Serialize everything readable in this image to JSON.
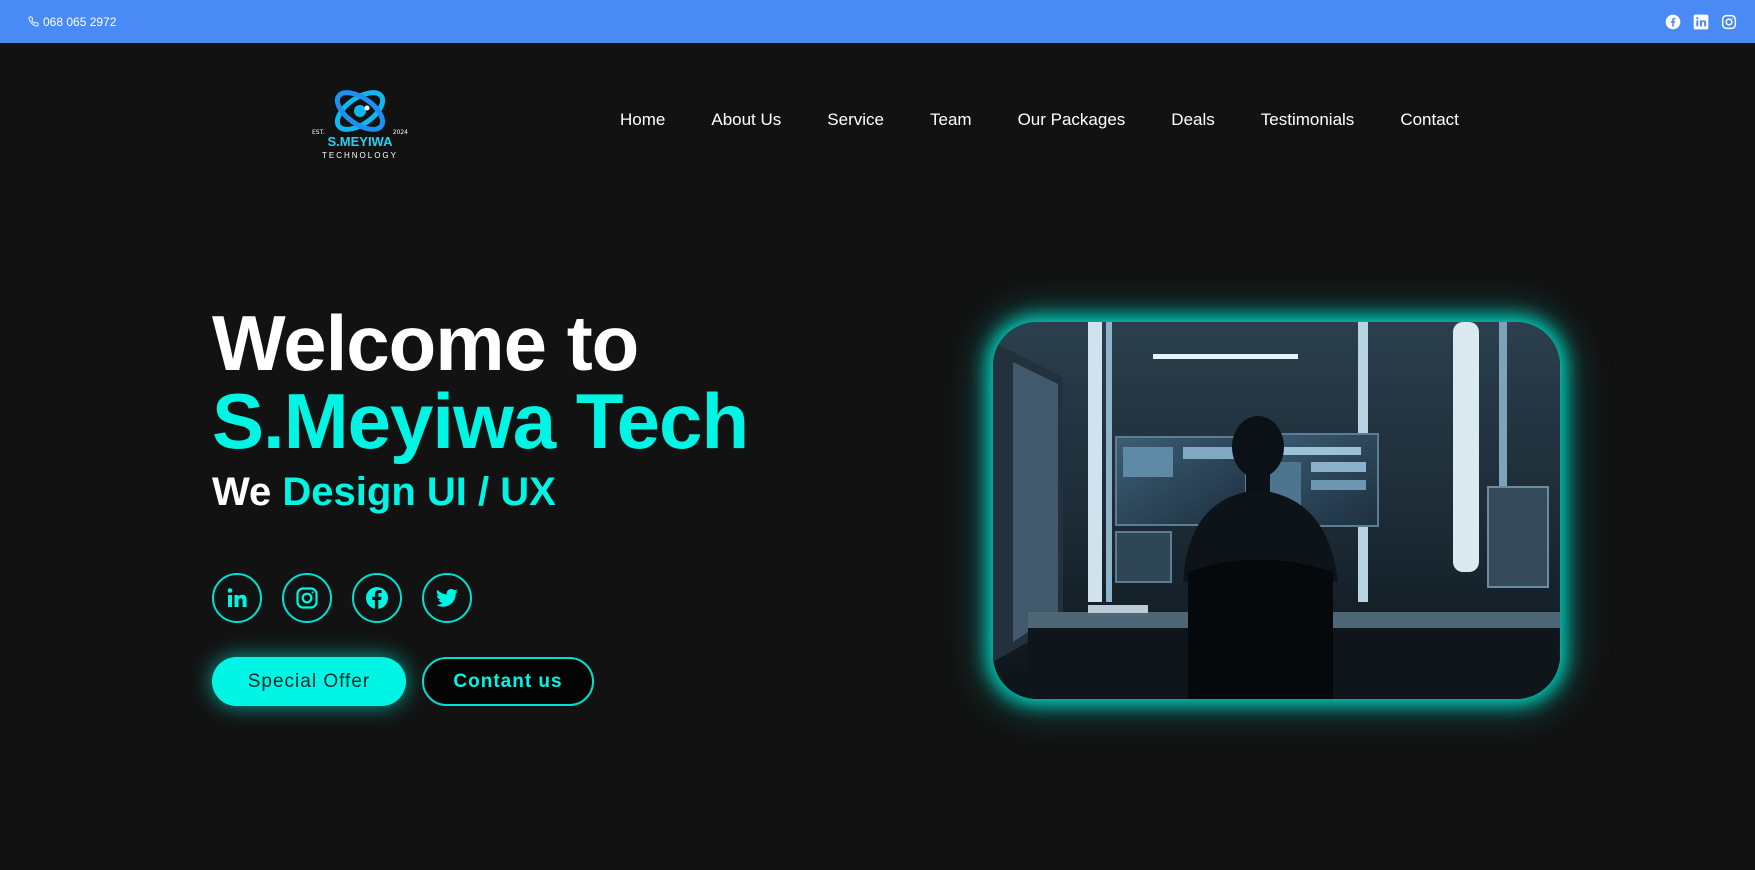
{
  "topbar": {
    "phone": "068 065 2972",
    "social_icons": [
      "facebook-icon",
      "linkedin-icon",
      "instagram-icon"
    ],
    "background": "#4a8af4"
  },
  "logo": {
    "est": "EST.",
    "year": "2024",
    "name": "S.MEYIWA",
    "tagline": "TECHNOLOGY"
  },
  "nav": {
    "items": [
      "Home",
      "About Us",
      "Service",
      "Team",
      "Our Packages",
      "Deals",
      "Testimonials",
      "Contact"
    ]
  },
  "hero": {
    "line1": "Welcome to",
    "line2": "S.Meyiwa Tech",
    "line3_prefix": "We",
    "line3_highlight": "Design UI / UX",
    "social_icons": [
      "linkedin-icon",
      "instagram-icon",
      "facebook-icon",
      "twitter-icon"
    ],
    "special_offer_label": "Special Offer",
    "contact_label": "Contant us"
  },
  "colors": {
    "accent": "#00f5e4",
    "background": "#121212",
    "topbar": "#4a8af4"
  }
}
